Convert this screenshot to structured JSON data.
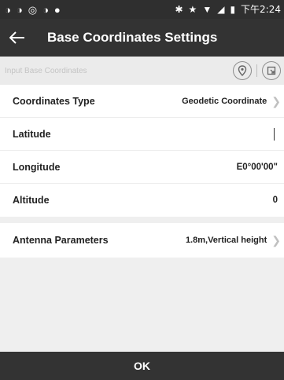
{
  "status_bar": {
    "left_icons": [
      "◑",
      "◑",
      "◎",
      "◑",
      "●"
    ],
    "right_icons": [
      "✱",
      "★",
      "▼",
      "◢",
      "▮"
    ],
    "time": "下午2:24"
  },
  "app_bar": {
    "title": "Base Coordinates Settings",
    "back_icon": "arrow-left-icon"
  },
  "section": {
    "label": "Input Base Coordinates",
    "icons": [
      "location-pin-icon",
      "import-icon"
    ]
  },
  "rows": [
    {
      "label": "Coordinates Type",
      "value": "Geodetic Coordinate",
      "chevron": true
    },
    {
      "label": "Latitude",
      "value": ""
    },
    {
      "label": "Longitude",
      "value": "E0°00'00\""
    },
    {
      "label": "Altitude",
      "value": "0"
    }
  ],
  "antenna": {
    "label": "Antenna Parameters",
    "value": "1.8m,Vertical height"
  },
  "ok_button": "OK"
}
